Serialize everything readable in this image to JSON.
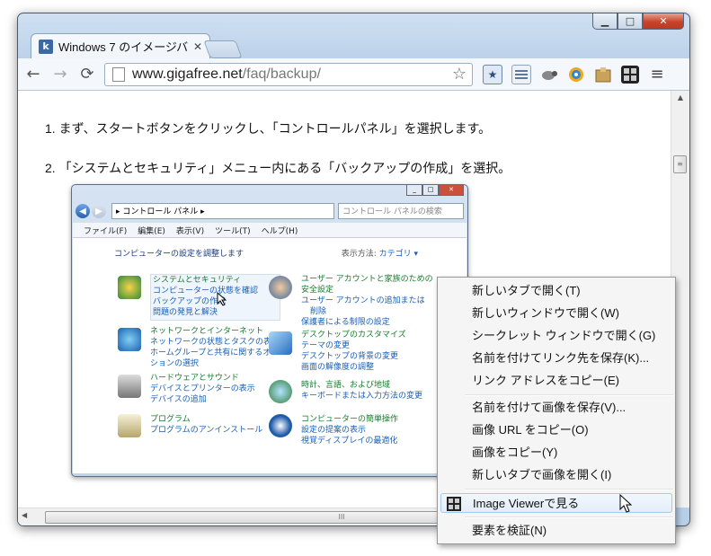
{
  "window": {
    "controls": {
      "minimize": "▁",
      "maximize": "□",
      "close": "✕"
    }
  },
  "tab": {
    "title": "Windows 7 のイメージバ",
    "close": "✕",
    "icon": "page-favicon"
  },
  "toolbar": {
    "back": "←",
    "forward": "→",
    "reload": "⟳",
    "url_host": "www.gigafree.net",
    "url_path": "/faq/backup/",
    "star": "☆",
    "menu": "≡"
  },
  "page": {
    "steps": [
      "1.  まず、スタートボタンをクリックし、「コントロールパネル」を選択します。",
      "2.  「システムとセキュリティ」メニュー内にある「バックアップの作成」を選択。"
    ]
  },
  "control_panel": {
    "path": "▸ コントロール パネル ▸",
    "search_placeholder": "コントロール パネルの検索",
    "menu": [
      "ファイル(F)",
      "編集(E)",
      "表示(V)",
      "ツール(T)",
      "ヘルプ(H)"
    ],
    "heading": "コンピューターの設定を調整します",
    "view_label": "表示方法:",
    "view_value": "カテゴリ ▾",
    "categories": [
      {
        "title": "システムとセキュリティ",
        "links": [
          "コンピューターの状態を確認",
          "バックアップの作成",
          "問題の発見と解決"
        ]
      },
      {
        "title": "ネットワークとインターネット",
        "links": [
          "ネットワークの状態とタスクの表示",
          "ホームグループと共有に関するオプ",
          "ションの選択"
        ]
      },
      {
        "title": "ハードウェアとサウンド",
        "links": [
          "デバイスとプリンターの表示",
          "デバイスの追加"
        ]
      },
      {
        "title": "プログラム",
        "links": [
          "プログラムのアンインストール"
        ]
      },
      {
        "title": "ユーザー アカウントと家族のための",
        "links": [
          "安全設定",
          "ユーザー アカウントの追加または",
          "削除",
          "保護者による制限の設定"
        ]
      },
      {
        "title": "デスクトップのカスタマイズ",
        "links": [
          "テーマの変更",
          "デスクトップの背景の変更",
          "画面の解像度の調整"
        ]
      },
      {
        "title": "時計、言語、および地域",
        "links": [
          "キーボードまたは入力方法の変更"
        ]
      },
      {
        "title": "コンピューターの簡単操作",
        "links": [
          "設定の提案の表示",
          "視覚ディスプレイの最適化"
        ]
      }
    ]
  },
  "context_menu": {
    "items": [
      "新しいタブで開く(T)",
      "新しいウィンドウで開く(W)",
      "シークレット ウィンドウで開く(G)",
      "名前を付けてリンク先を保存(K)...",
      "リンク アドレスをコピー(E)",
      "名前を付けて画像を保存(V)...",
      "画像 URL をコピー(O)",
      "画像をコピー(Y)",
      "新しいタブで画像を開く(I)",
      "Image Viewerで見る",
      "要素を検証(N)"
    ]
  },
  "scrollbar": {
    "grip": "III",
    "grip_v": "≡"
  }
}
